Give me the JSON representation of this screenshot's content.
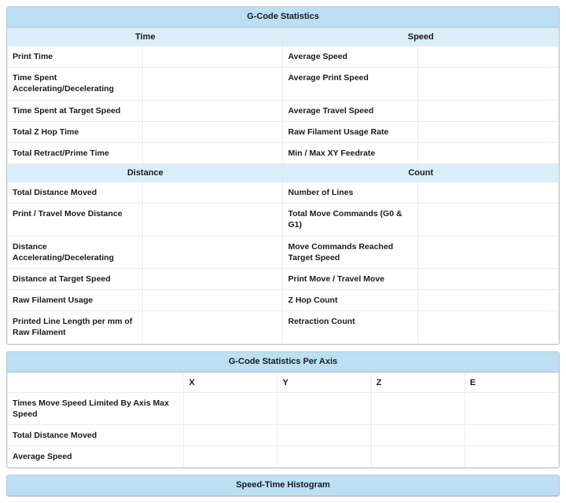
{
  "panels": {
    "stats": {
      "title": "G-Code Statistics",
      "sections": {
        "time": "Time",
        "speed": "Speed",
        "distance": "Distance",
        "count": "Count"
      },
      "rows1": [
        {
          "left_label": "Print Time",
          "left_value": "",
          "right_label": "Average Speed",
          "right_value": ""
        },
        {
          "left_label": "Time Spent Accelerating/Decelerating",
          "left_value": "",
          "right_label": "Average Print Speed",
          "right_value": ""
        },
        {
          "left_label": "Time Spent at Target Speed",
          "left_value": "",
          "right_label": "Average Travel Speed",
          "right_value": ""
        },
        {
          "left_label": "Total Z Hop Time",
          "left_value": "",
          "right_label": "Raw Filament Usage Rate",
          "right_value": ""
        },
        {
          "left_label": "Total Retract/Prime Time",
          "left_value": "",
          "right_label": "Min / Max XY Feedrate",
          "right_value": ""
        }
      ],
      "rows2": [
        {
          "left_label": "Total Distance Moved",
          "left_value": "",
          "right_label": "Number of Lines",
          "right_value": ""
        },
        {
          "left_label": "Print / Travel Move Distance",
          "left_value": "",
          "right_label": "Total Move Commands (G0 & G1)",
          "right_value": ""
        },
        {
          "left_label": "Distance Accelerating/Decelerating",
          "left_value": "",
          "right_label": "Move Commands Reached Target Speed",
          "right_value": ""
        },
        {
          "left_label": "Distance at Target Speed",
          "left_value": "",
          "right_label": "Print Move / Travel Move",
          "right_value": ""
        },
        {
          "left_label": "Raw Filament Usage",
          "left_value": "",
          "right_label": "Z Hop Count",
          "right_value": ""
        },
        {
          "left_label": "Printed Line Length per mm of Raw Filament",
          "left_value": "",
          "right_label": "Retraction Count",
          "right_value": ""
        }
      ]
    },
    "perAxis": {
      "title": "G-Code Statistics Per Axis",
      "headers": {
        "blank": "",
        "x": "X",
        "y": "Y",
        "z": "Z",
        "e": "E"
      },
      "rows": [
        {
          "label": "Times Move Speed Limited By Axis Max Speed",
          "x": "",
          "y": "",
          "z": "",
          "e": ""
        },
        {
          "label": "Total Distance Moved",
          "x": "",
          "y": "",
          "z": "",
          "e": ""
        },
        {
          "label": "Average Speed",
          "x": "",
          "y": "",
          "z": "",
          "e": ""
        }
      ]
    },
    "histogram": {
      "title": "Speed-Time Histogram"
    }
  }
}
